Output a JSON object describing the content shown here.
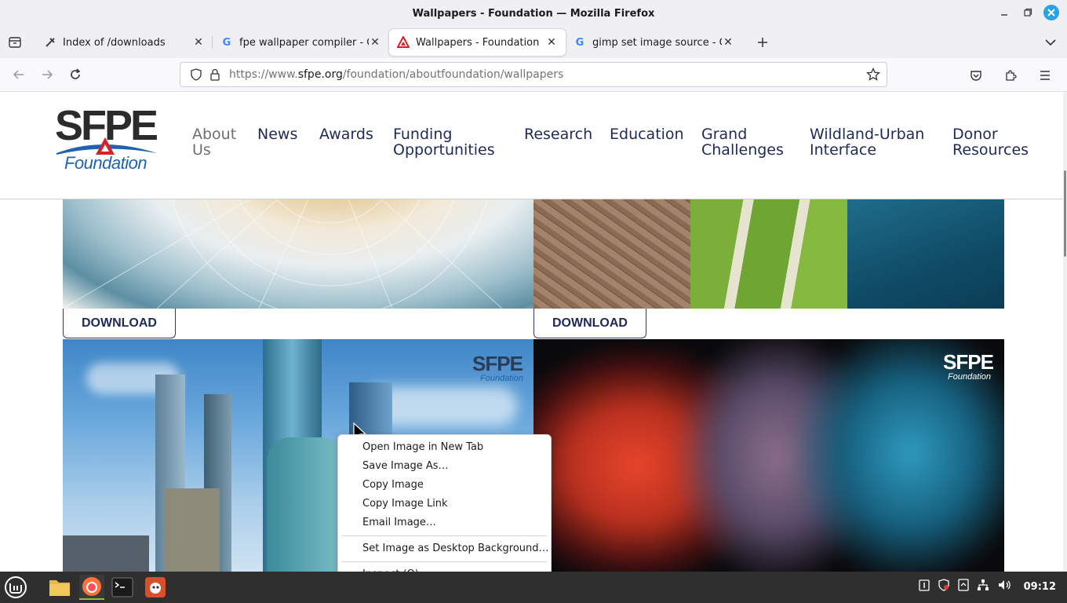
{
  "window": {
    "title": "Wallpapers - Foundation — Mozilla Firefox"
  },
  "tabs": [
    {
      "label": "Index of /downloads",
      "favicon": "puzzle-icon",
      "active": false
    },
    {
      "label": "fpe wallpaper compiler - Go",
      "favicon": "google-icon",
      "active": false
    },
    {
      "label": "Wallpapers - Foundation",
      "favicon": "sfpe-icon",
      "active": true
    },
    {
      "label": "gimp set image source - Go",
      "favicon": "google-icon",
      "active": false
    }
  ],
  "url": {
    "scheme": "https://www.",
    "host": "sfpe.org",
    "path": "/foundation/aboutfoundation/wallpapers"
  },
  "site": {
    "logo_text": "SFPE",
    "logo_sub": "Foundation",
    "nav": [
      {
        "line1": "About",
        "line2": "Us"
      },
      {
        "line1": "News",
        "line2": ""
      },
      {
        "line1": "Awards",
        "line2": ""
      },
      {
        "line1": "Funding",
        "line2": "Opportunities"
      },
      {
        "line1": "Research",
        "line2": ""
      },
      {
        "line1": "Education",
        "line2": ""
      },
      {
        "line1": "Grand",
        "line2": "Challenges"
      },
      {
        "line1": "Wildland-Urban",
        "line2": "Interface"
      },
      {
        "line1": "Donor",
        "line2": "Resources"
      }
    ]
  },
  "wallpapers": {
    "download_label": "DOWNLOAD",
    "watermark_main": "SFPE",
    "watermark_sub": "Foundation"
  },
  "context_menu": {
    "items": [
      "Open Image in New Tab",
      "Save Image As…",
      "Copy Image",
      "Copy Image Link",
      "Email Image…",
      "Set Image as Desktop Background…",
      "Inspect (Q)"
    ]
  },
  "taskbar": {
    "clock": "09:12"
  },
  "colors": {
    "accent": "#2aa3e6",
    "brand_navy": "#1e2a56",
    "brand_blue": "#1f63b0",
    "brand_red": "#d2232a"
  }
}
